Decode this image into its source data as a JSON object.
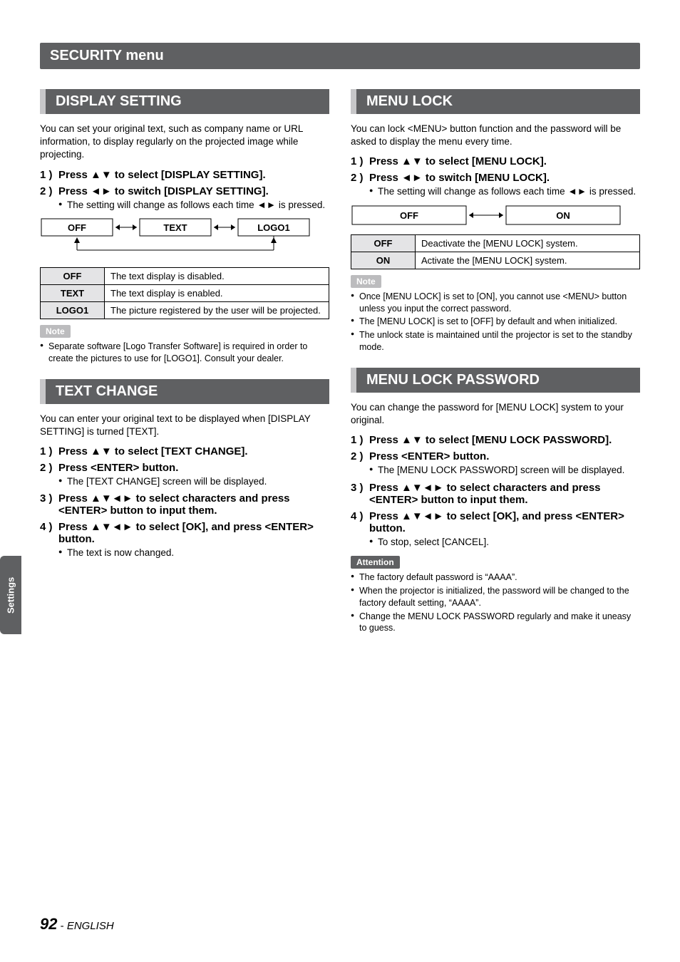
{
  "menu_title": "SECURITY menu",
  "side_tab": "Settings",
  "footer": {
    "page": "92",
    "sep": " - ",
    "lang": "ENGLISH"
  },
  "left": {
    "display_setting": {
      "title": "DISPLAY SETTING",
      "intro": "You can set your original text, such as company name or URL information, to display regularly on the projected image while projecting.",
      "steps": [
        {
          "n": "1 )",
          "t": "Press ▲▼ to select [DISPLAY SETTING]."
        },
        {
          "n": "2 )",
          "t": "Press ◄► to switch [DISPLAY SETTING]."
        }
      ],
      "sub": "The setting will change as follows each time ◄► is pressed.",
      "diagram": {
        "a": "OFF",
        "b": "TEXT",
        "c": "LOGO1"
      },
      "table": [
        {
          "k": "OFF",
          "v": "The text display is disabled."
        },
        {
          "k": "TEXT",
          "v": "The text display is enabled."
        },
        {
          "k": "LOGO1",
          "v": "The picture registered by the user will be projected."
        }
      ],
      "note_label": "Note",
      "notes": [
        "Separate software [Logo Transfer Software] is required in order to create the pictures to use for [LOGO1]. Consult your dealer."
      ]
    },
    "text_change": {
      "title": "TEXT CHANGE",
      "intro": "You can enter your original text to be displayed when [DISPLAY SETTING] is turned [TEXT].",
      "steps": [
        {
          "n": "1 )",
          "t": "Press ▲▼ to select [TEXT CHANGE]."
        },
        {
          "n": "2 )",
          "t": "Press <ENTER> button."
        },
        {
          "n": "3 )",
          "t": "Press ▲▼◄► to select characters and press <ENTER> button to input them."
        },
        {
          "n": "4 )",
          "t": "Press ▲▼◄► to select [OK], and press <ENTER> button."
        }
      ],
      "sub2": "The [TEXT CHANGE] screen will be displayed.",
      "sub4": "The text is now changed."
    }
  },
  "right": {
    "menu_lock": {
      "title": "MENU LOCK",
      "intro": "You can lock <MENU> button function and the password will be asked to display the menu every time.",
      "steps": [
        {
          "n": "1 )",
          "t": "Press ▲▼ to select [MENU LOCK]."
        },
        {
          "n": "2 )",
          "t": "Press ◄► to switch [MENU LOCK]."
        }
      ],
      "sub": "The setting will change as follows each time ◄► is pressed.",
      "diagram": {
        "a": "OFF",
        "b": "ON"
      },
      "table": [
        {
          "k": "OFF",
          "v": "Deactivate the [MENU LOCK] system."
        },
        {
          "k": "ON",
          "v": "Activate the [MENU LOCK] system."
        }
      ],
      "note_label": "Note",
      "notes": [
        "Once [MENU LOCK] is set to [ON], you cannot use <MENU> button unless you input the correct password.",
        "The [MENU LOCK] is set to [OFF] by default and when initialized.",
        "The unlock state is maintained until the projector is set to the standby mode."
      ]
    },
    "menu_lock_pw": {
      "title": "MENU LOCK PASSWORD",
      "intro": "You can change the password for [MENU LOCK] system to your original.",
      "steps": [
        {
          "n": "1 )",
          "t": "Press ▲▼ to select [MENU LOCK PASSWORD]."
        },
        {
          "n": "2 )",
          "t": "Press <ENTER> button."
        },
        {
          "n": "3 )",
          "t": "Press ▲▼◄► to select characters and press <ENTER> button to input them."
        },
        {
          "n": "4 )",
          "t": "Press ▲▼◄► to select [OK], and press <ENTER> button."
        }
      ],
      "sub2": "The [MENU LOCK PASSWORD] screen will be displayed.",
      "sub4": "To stop, select [CANCEL].",
      "attn_label": "Attention",
      "attn": [
        "The factory default password is “AAAA”.",
        "When the projector is initialized, the password will be changed to the factory default setting, “AAAA”.",
        "Change the MENU LOCK PASSWORD regularly and make it uneasy to guess."
      ]
    }
  }
}
